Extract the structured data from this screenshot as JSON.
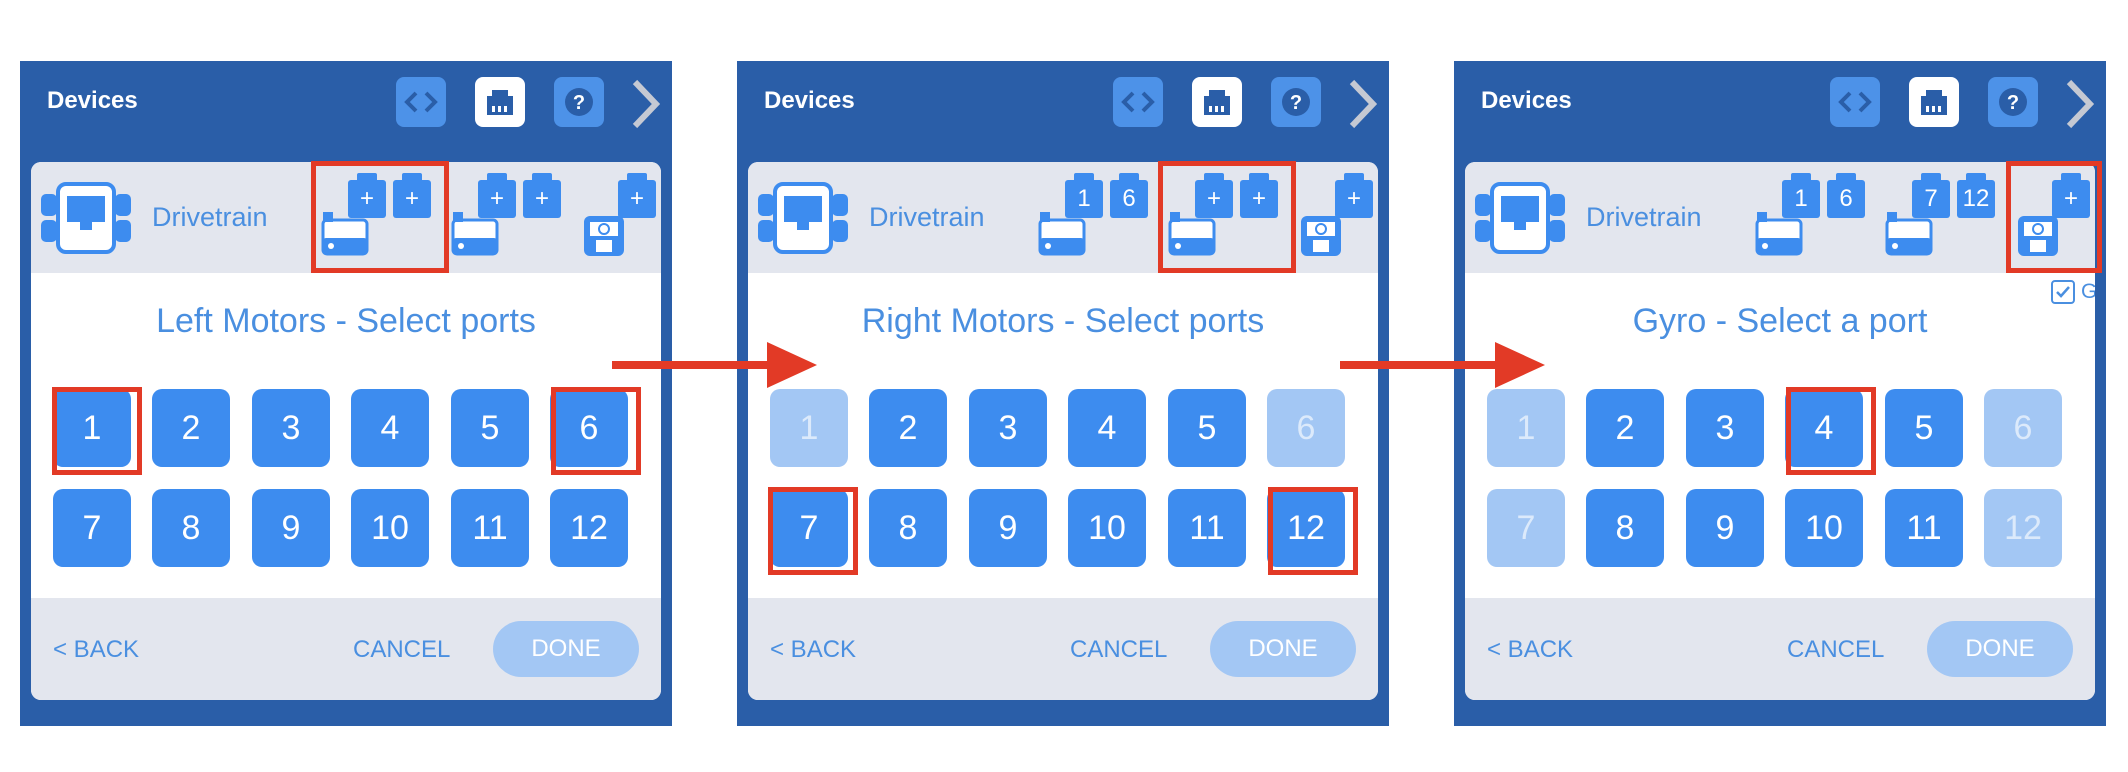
{
  "colors": {
    "header": "#2a5ea8",
    "accent": "#3d8cef",
    "text_accent": "#4a8fe0",
    "disabled": "#a3c7f4",
    "highlight": "#e23a26"
  },
  "panels": [
    {
      "header": {
        "title": "Devices",
        "icons": [
          "code-icon",
          "device-port-icon",
          "help-icon",
          "chevron-right-icon"
        ]
      },
      "drivetrain": {
        "label": "Drivetrain"
      },
      "slots": [
        {
          "chips": [
            "+",
            "+"
          ]
        },
        {
          "chips": [
            "+",
            "+"
          ]
        },
        {
          "chips": [
            "+"
          ]
        }
      ],
      "title": "Left Motors - Select ports",
      "ports": [
        "1",
        "2",
        "3",
        "4",
        "5",
        "6",
        "7",
        "8",
        "9",
        "10",
        "11",
        "12"
      ],
      "disabled_ports": [],
      "footer": {
        "back": "< BACK",
        "cancel": "CANCEL",
        "done": "DONE"
      }
    },
    {
      "header": {
        "title": "Devices",
        "icons": [
          "code-icon",
          "device-port-icon",
          "help-icon",
          "chevron-right-icon"
        ]
      },
      "drivetrain": {
        "label": "Drivetrain"
      },
      "slots": [
        {
          "chips": [
            "1",
            "6"
          ]
        },
        {
          "chips": [
            "+",
            "+"
          ]
        },
        {
          "chips": [
            "+"
          ]
        }
      ],
      "title": "Right Motors - Select ports",
      "ports": [
        "1",
        "2",
        "3",
        "4",
        "5",
        "6",
        "7",
        "8",
        "9",
        "10",
        "11",
        "12"
      ],
      "disabled_ports": [
        "1",
        "6"
      ],
      "footer": {
        "back": "< BACK",
        "cancel": "CANCEL",
        "done": "DONE"
      }
    },
    {
      "header": {
        "title": "Devices",
        "icons": [
          "code-icon",
          "device-port-icon",
          "help-icon",
          "chevron-right-icon"
        ]
      },
      "drivetrain": {
        "label": "Drivetrain"
      },
      "slots": [
        {
          "chips": [
            "1",
            "6"
          ]
        },
        {
          "chips": [
            "7",
            "12"
          ]
        },
        {
          "chips": [
            "+"
          ]
        }
      ],
      "gyro_checkbox": {
        "label": "GYRO",
        "checked": true
      },
      "title": "Gyro - Select a port",
      "ports": [
        "1",
        "2",
        "3",
        "4",
        "5",
        "6",
        "7",
        "8",
        "9",
        "10",
        "11",
        "12"
      ],
      "disabled_ports": [
        "1",
        "6",
        "7",
        "12"
      ],
      "footer": {
        "back": "< BACK",
        "cancel": "CANCEL",
        "done": "DONE"
      }
    }
  ]
}
